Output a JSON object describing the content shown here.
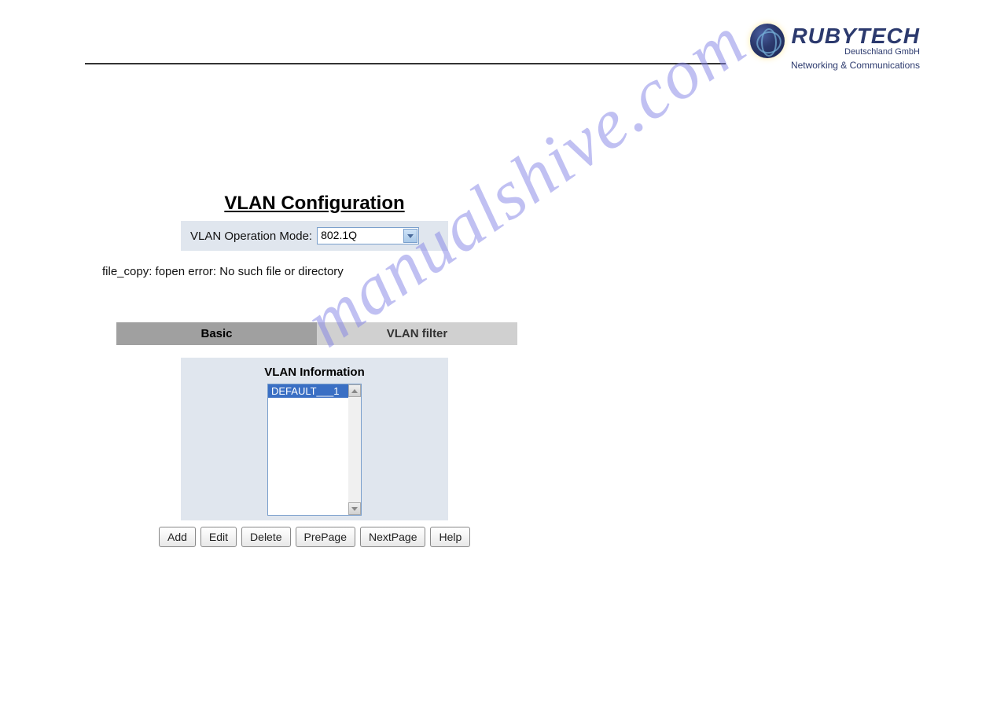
{
  "logo": {
    "brand": "RUBYTECH",
    "subtitle": "Deutschland GmbH",
    "tagline": "Networking & Communications"
  },
  "watermark": "manualshive.com",
  "page": {
    "title": "VLAN Configuration",
    "modeLabel": "VLAN Operation Mode:",
    "modeValue": "802.1Q",
    "errorMessage": "file_copy: fopen error: No such file or directory"
  },
  "tabs": {
    "basic": "Basic",
    "vlanFilter": "VLAN filter"
  },
  "infoPanel": {
    "title": "VLAN Information",
    "items": [
      "DEFAULT___1"
    ]
  },
  "buttons": {
    "add": "Add",
    "edit": "Edit",
    "delete": "Delete",
    "prePage": "PrePage",
    "nextPage": "NextPage",
    "help": "Help"
  }
}
